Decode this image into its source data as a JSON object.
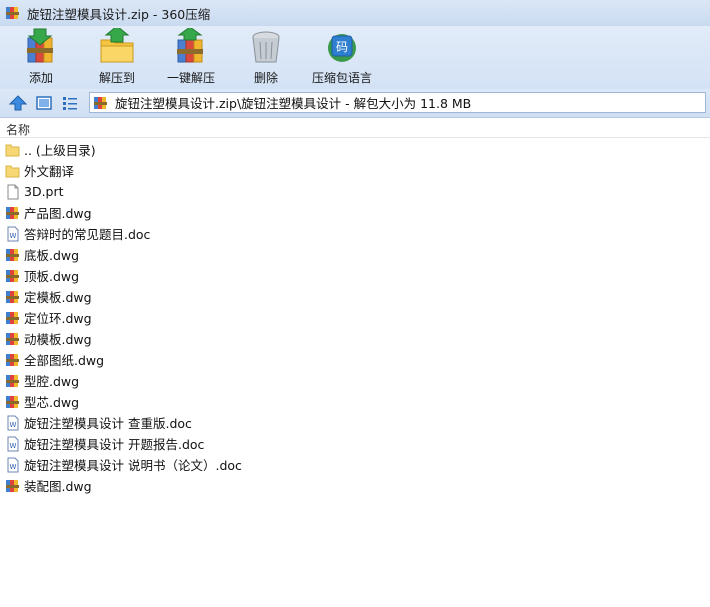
{
  "window": {
    "title": "旋钮注塑模具设计.zip - 360压缩"
  },
  "toolbar": {
    "buttons": [
      {
        "label": "添加",
        "icon": "add-books-icon"
      },
      {
        "label": "解压到",
        "icon": "extract-folder-icon"
      },
      {
        "label": "一键解压",
        "icon": "one-click-extract-icon"
      },
      {
        "label": "删除",
        "icon": "trash-bin-icon"
      },
      {
        "label": "压缩包语言",
        "icon": "codepage-icon"
      }
    ],
    "codepage_badge": "码"
  },
  "nav": {
    "path": "旋钮注塑模具设计.zip\\旋钮注塑模具设计 - 解包大小为 11.8 MB"
  },
  "list": {
    "column_name": "名称",
    "items": [
      {
        "name": ".. (上级目录)",
        "type": "folder"
      },
      {
        "name": "外文翻译",
        "type": "folder"
      },
      {
        "name": "3D.prt",
        "type": "file"
      },
      {
        "name": "产品图.dwg",
        "type": "dwg"
      },
      {
        "name": "答辩时的常见题目.doc",
        "type": "doc"
      },
      {
        "name": "底板.dwg",
        "type": "dwg"
      },
      {
        "name": "顶板.dwg",
        "type": "dwg"
      },
      {
        "name": "定模板.dwg",
        "type": "dwg"
      },
      {
        "name": "定位环.dwg",
        "type": "dwg"
      },
      {
        "name": "动模板.dwg",
        "type": "dwg"
      },
      {
        "name": "全部图纸.dwg",
        "type": "dwg"
      },
      {
        "name": "型腔.dwg",
        "type": "dwg"
      },
      {
        "name": "型芯.dwg",
        "type": "dwg"
      },
      {
        "name": "旋钮注塑模具设计 查重版.doc",
        "type": "doc"
      },
      {
        "name": "旋钮注塑模具设计 开题报告.doc",
        "type": "doc"
      },
      {
        "name": "旋钮注塑模具设计 说明书（论文）.doc",
        "type": "doc"
      },
      {
        "name": "装配图.dwg",
        "type": "dwg"
      }
    ]
  }
}
